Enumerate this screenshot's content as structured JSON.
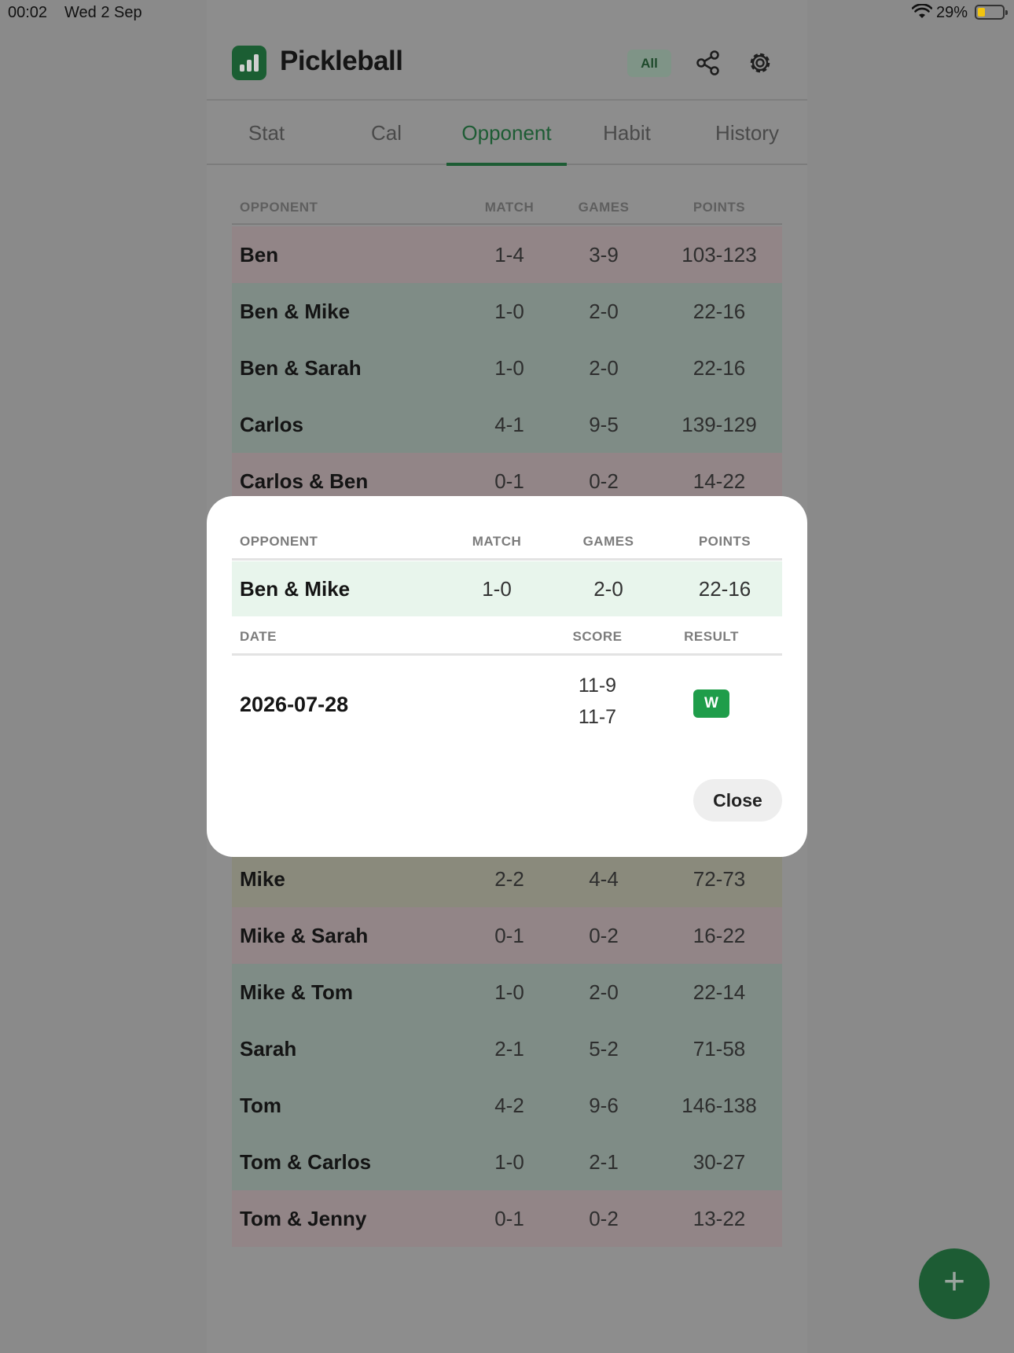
{
  "status_bar": {
    "time": "00:02",
    "date": "Wed 2 Sep",
    "battery_percent": "29%",
    "battery_level": 0.29,
    "battery_color": "#f1c40f"
  },
  "header": {
    "app_title": "Pickleball",
    "filter_badge": "All",
    "icons": [
      "bar-chart-logo-icon",
      "share-icon",
      "gear-icon"
    ]
  },
  "tabs": [
    {
      "label": "Stat",
      "active": false
    },
    {
      "label": "Cal",
      "active": false
    },
    {
      "label": "Opponent",
      "active": true
    },
    {
      "label": "Habit",
      "active": false
    },
    {
      "label": "History",
      "active": false
    }
  ],
  "table": {
    "columns": [
      "OPPONENT",
      "MATCH",
      "GAMES",
      "POINTS"
    ],
    "rows_top": [
      {
        "name": "Ben",
        "match": "1-4",
        "games": "3-9",
        "points": "103-123",
        "status": "loss"
      },
      {
        "name": "Ben & Mike",
        "match": "1-0",
        "games": "2-0",
        "points": "22-16",
        "status": "win"
      },
      {
        "name": "Ben & Sarah",
        "match": "1-0",
        "games": "2-0",
        "points": "22-16",
        "status": "win"
      },
      {
        "name": "Carlos",
        "match": "4-1",
        "games": "9-5",
        "points": "139-129",
        "status": "win"
      },
      {
        "name": "Carlos & Ben",
        "match": "0-1",
        "games": "0-2",
        "points": "14-22",
        "status": "loss"
      }
    ],
    "rows_bottom": [
      {
        "name": "Mike",
        "match": "2-2",
        "games": "4-4",
        "points": "72-73",
        "status": "even"
      },
      {
        "name": "Mike & Sarah",
        "match": "0-1",
        "games": "0-2",
        "points": "16-22",
        "status": "loss"
      },
      {
        "name": "Mike & Tom",
        "match": "1-0",
        "games": "2-0",
        "points": "22-14",
        "status": "win"
      },
      {
        "name": "Sarah",
        "match": "2-1",
        "games": "5-2",
        "points": "71-58",
        "status": "win"
      },
      {
        "name": "Tom",
        "match": "4-2",
        "games": "9-6",
        "points": "146-138",
        "status": "win"
      },
      {
        "name": "Tom & Carlos",
        "match": "1-0",
        "games": "2-1",
        "points": "30-27",
        "status": "win"
      },
      {
        "name": "Tom & Jenny",
        "match": "0-1",
        "games": "0-2",
        "points": "13-22",
        "status": "loss"
      }
    ]
  },
  "fab": {
    "label": "+"
  },
  "modal": {
    "columns": [
      "OPPONENT",
      "MATCH",
      "GAMES",
      "POINTS"
    ],
    "summary": {
      "name": "Ben & Mike",
      "match": "1-0",
      "games": "2-0",
      "points": "22-16"
    },
    "sub_columns": [
      "DATE",
      "SCORE",
      "RESULT"
    ],
    "entry": {
      "date": "2026-07-28",
      "scores": [
        "11-9",
        "11-7"
      ],
      "result": "W"
    },
    "close_label": "Close"
  }
}
